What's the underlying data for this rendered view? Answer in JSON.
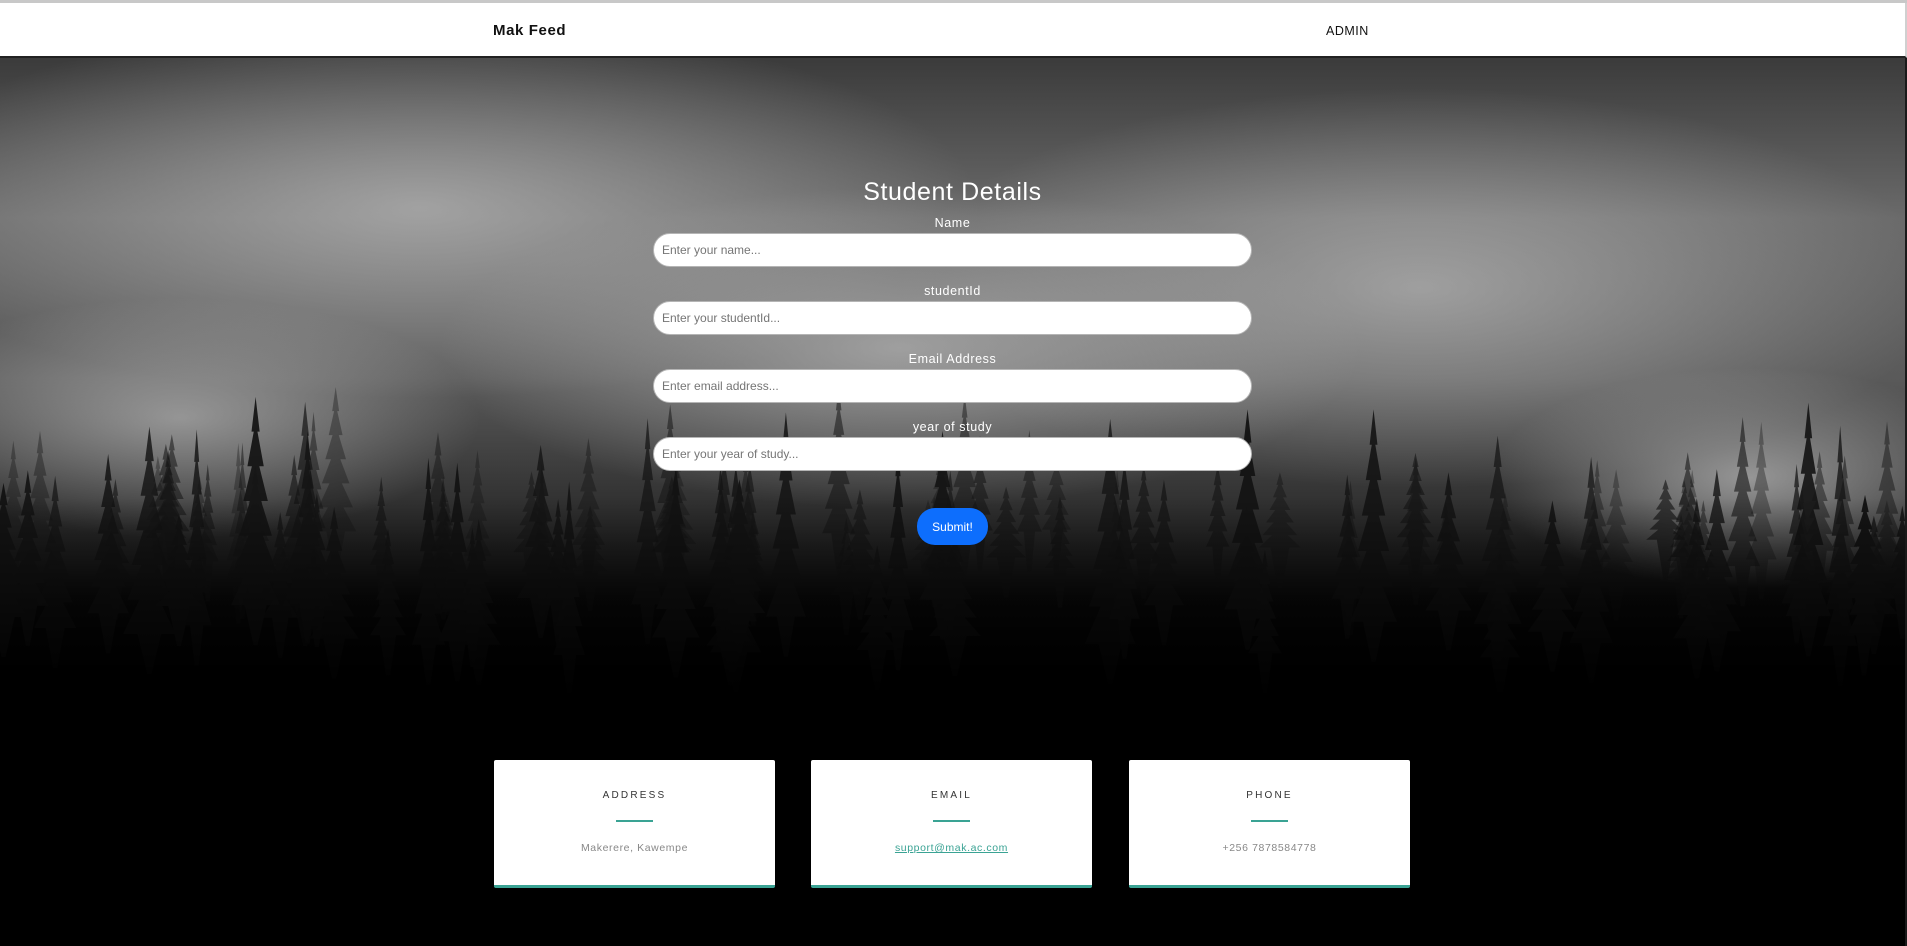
{
  "navbar": {
    "brand": "Mak Feed",
    "admin_link": "ADMIN"
  },
  "form": {
    "title": "Student Details",
    "fields": [
      {
        "label": "Name",
        "placeholder": "Enter your name...",
        "value": ""
      },
      {
        "label": "studentId",
        "placeholder": "Enter your studentId...",
        "value": ""
      },
      {
        "label": "Email Address",
        "placeholder": "Enter email address...",
        "value": ""
      },
      {
        "label": "year of study",
        "placeholder": "Enter your year of study...",
        "value": ""
      }
    ],
    "submit_label": "Submit!"
  },
  "contact_cards": [
    {
      "title": "ADDRESS",
      "value": "Makerere, Kawempe"
    },
    {
      "title": "EMAIL",
      "value": "support@mak.ac.com"
    },
    {
      "title": "PHONE",
      "value": "+256 7878584778"
    }
  ],
  "colors": {
    "accent_teal": "#3aa394",
    "submit_blue": "#0d6efd",
    "navbar_bg": "#ffffff",
    "page_bg": "#000000"
  }
}
